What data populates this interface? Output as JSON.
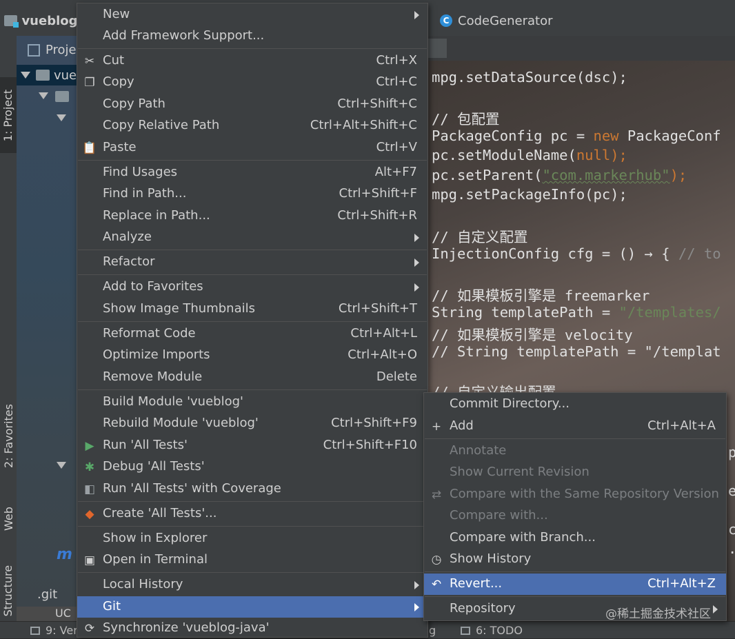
{
  "ide": {
    "project_name": "vueblog-",
    "project_tab": "Proje",
    "project_root": "vue",
    "tool_windows": {
      "project": "1: Project",
      "favorites": "2: Favorites",
      "web": "Web",
      "structure": "7: Structure"
    },
    "tree_files": {
      "m_icon_label": "m",
      "git_file": ".git",
      "uc_file": "UC"
    },
    "bottom_tabs": {
      "version": "9: Ver",
      "todo": "6: TODO",
      "log_fragment": "g"
    },
    "editor": {
      "tab_title": "CodeGenerator",
      "class_icon_letter": "C",
      "code_lines": {
        "l0": "mpg.setDataSource(dsc);",
        "l1": "// 包配置",
        "l2a": "PackageConfig pc = ",
        "l2b": "new",
        "l2c": " PackageConf",
        "l3a": "pc.setModuleName(",
        "l3b": "null",
        "l3c": ");",
        "l4a": "pc.setParent(",
        "l4b": "\"com.markerhub\"",
        "l4c": ");",
        "l5": "mpg.setPackageInfo(pc);",
        "l6": "// 自定义配置",
        "l7a": "InjectionConfig cfg = () → { ",
        "l7b": "// to",
        "l8": "// 如果模板引擎是 freemarker",
        "l9a": "String templatePath = ",
        "l9b": "\"/templates/",
        "l10": "// 如果模板引擎是 velocity",
        "l11": "// String templatePath = \"/templat",
        "l12": "// 自定义输出配置"
      },
      "peek_chars": [
        "p",
        "e",
        "c",
        "."
      ]
    }
  },
  "context_menu": {
    "items": [
      {
        "label": "New",
        "shortcut": "",
        "submenu": true
      },
      {
        "label": "Add Framework Support...",
        "shortcut": ""
      },
      {
        "label": "Cut",
        "shortcut": "Ctrl+X",
        "icon": "scissors-icon"
      },
      {
        "label": "Copy",
        "shortcut": "Ctrl+C",
        "icon": "copy-icon"
      },
      {
        "label": "Copy Path",
        "shortcut": "Ctrl+Shift+C"
      },
      {
        "label": "Copy Relative Path",
        "shortcut": "Ctrl+Alt+Shift+C"
      },
      {
        "label": "Paste",
        "shortcut": "Ctrl+V",
        "icon": "paste-icon"
      },
      {
        "label": "Find Usages",
        "shortcut": "Alt+F7"
      },
      {
        "label": "Find in Path...",
        "shortcut": "Ctrl+Shift+F"
      },
      {
        "label": "Replace in Path...",
        "shortcut": "Ctrl+Shift+R"
      },
      {
        "label": "Analyze",
        "shortcut": "",
        "submenu": true
      },
      {
        "label": "Refactor",
        "shortcut": "",
        "submenu": true
      },
      {
        "label": "Add to Favorites",
        "shortcut": "",
        "submenu": true
      },
      {
        "label": "Show Image Thumbnails",
        "shortcut": "Ctrl+Shift+T"
      },
      {
        "label": "Reformat Code",
        "shortcut": "Ctrl+Alt+L"
      },
      {
        "label": "Optimize Imports",
        "shortcut": "Ctrl+Alt+O"
      },
      {
        "label": "Remove Module",
        "shortcut": "Delete"
      },
      {
        "label": "Build Module 'vueblog'",
        "shortcut": ""
      },
      {
        "label": "Rebuild Module 'vueblog'",
        "shortcut": "Ctrl+Shift+F9"
      },
      {
        "label": "Run 'All Tests'",
        "shortcut": "Ctrl+Shift+F10",
        "icon": "run-icon"
      },
      {
        "label": "Debug 'All Tests'",
        "shortcut": "",
        "icon": "debug-icon"
      },
      {
        "label": "Run 'All Tests' with Coverage",
        "shortcut": "",
        "icon": "coverage-icon"
      },
      {
        "label": "Create 'All Tests'...",
        "shortcut": "",
        "icon": "create-test-icon"
      },
      {
        "label": "Show in Explorer",
        "shortcut": ""
      },
      {
        "label": "Open in Terminal",
        "shortcut": "",
        "icon": "terminal-icon"
      },
      {
        "label": "Local History",
        "shortcut": "",
        "submenu": true
      },
      {
        "label": "Git",
        "shortcut": "",
        "submenu": true,
        "selected": true
      },
      {
        "label": "Synchronize 'vueblog-java'",
        "shortcut": "",
        "icon": "sync-icon"
      }
    ]
  },
  "git_submenu": {
    "items": [
      {
        "label": "Commit Directory...",
        "shortcut": ""
      },
      {
        "label": "Add",
        "shortcut": "Ctrl+Alt+A",
        "icon": "plus-icon"
      },
      {
        "label": "Annotate",
        "shortcut": "",
        "disabled": true
      },
      {
        "label": "Show Current Revision",
        "shortcut": "",
        "disabled": true
      },
      {
        "label": "Compare with the Same Repository Version",
        "shortcut": "",
        "disabled": true,
        "icon": "compare-icon"
      },
      {
        "label": "Compare with...",
        "shortcut": "",
        "disabled": true
      },
      {
        "label": "Compare with Branch...",
        "shortcut": ""
      },
      {
        "label": "Show History",
        "shortcut": "",
        "icon": "history-icon"
      },
      {
        "label": "Revert...",
        "shortcut": "Ctrl+Alt+Z",
        "selected": true,
        "icon": "revert-icon"
      },
      {
        "label": "Repository",
        "shortcut": "",
        "submenu": true
      }
    ]
  },
  "watermark": "@稀土掘金技术社区",
  "colors": {
    "menu_bg": "#3c3f41",
    "selection": "#4b6eaf",
    "disabled_text": "#7c7f82",
    "keyword": "#cc7832",
    "string": "#6a8759",
    "comment": "#8a8a8a"
  }
}
